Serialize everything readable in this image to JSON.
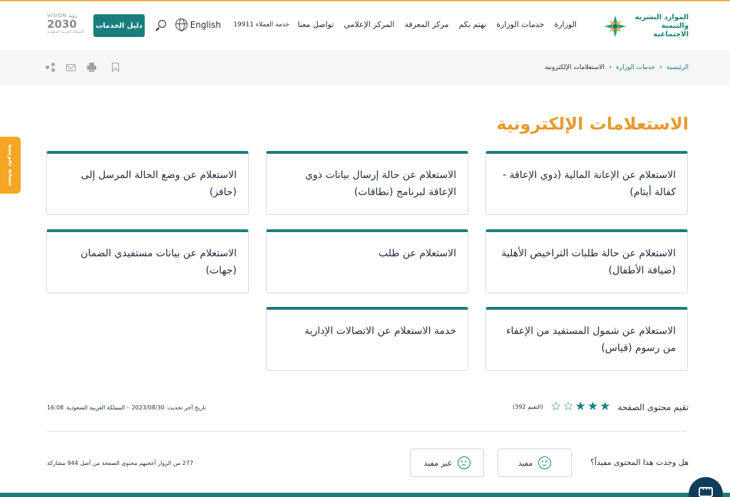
{
  "header": {
    "logo_line1": "الموارد البشرية",
    "logo_line2": "والتنمية الاجتماعية",
    "nav": [
      "الوزارة",
      "خدمات الوزارة",
      "نهتم بكم",
      "مركز المعرفة",
      "المركز الإعلامي",
      "تواصل معنا"
    ],
    "customer_service": "خدمة العملاء 19911",
    "language": "English",
    "guide_button": "دليل الخدمات",
    "vision_top": "VISION رؤية",
    "vision_year": "2030",
    "vision_sub": "المملكة العربية السعودية"
  },
  "breadcrumb": {
    "home": "الرئيسية",
    "services": "خدمات الوزارة",
    "current": "الاستعلامات الإلكترونية"
  },
  "side_tab": "نسخة تجريبية",
  "page_title": "الاستعلامات الإلكترونية",
  "cards": [
    "الاستعلام عن الإعانة المالية (ذوي الإعاقة - كفالة أيتام)",
    "الاستعلام عن حالة إرسال بيانات ذوي الإعاقة لبرنامج (نطاقات)",
    "الاستعلام عن وضع الحالة المرسل إلى (حافز)",
    "الاستعلام عن حالة طلبات التراخيص الأهلية (ضيافة الأطفال)",
    "الاستعلام عن طلب",
    "الاستعلام عن بيانات مستفيدي الضمان (جهات)",
    "الاستعلام عن شمول المستفيد من الإعفاء من رسوم (قياس)",
    "خدمة الاستعلام عن الاتصالات الإدارية"
  ],
  "rating": {
    "label": "تقيم محتوى الصفحة",
    "stars_filled": 3,
    "stars_total": 5,
    "count_text": "(التقيم 392)"
  },
  "updated": {
    "label": "تاريخ آخر تحديث",
    "date": "2023/08/30",
    "place": "- المملكة العربية السعودية",
    "time": "16:08"
  },
  "feedback": {
    "question": "هل وجدت هذا المحتوى مفيداً؟",
    "useful": "مفيد",
    "not_useful": "غير مفيد",
    "stats": "277 من الزوار أعجبهم محتوى الصفحة من أصل 944 مشاركة"
  }
}
